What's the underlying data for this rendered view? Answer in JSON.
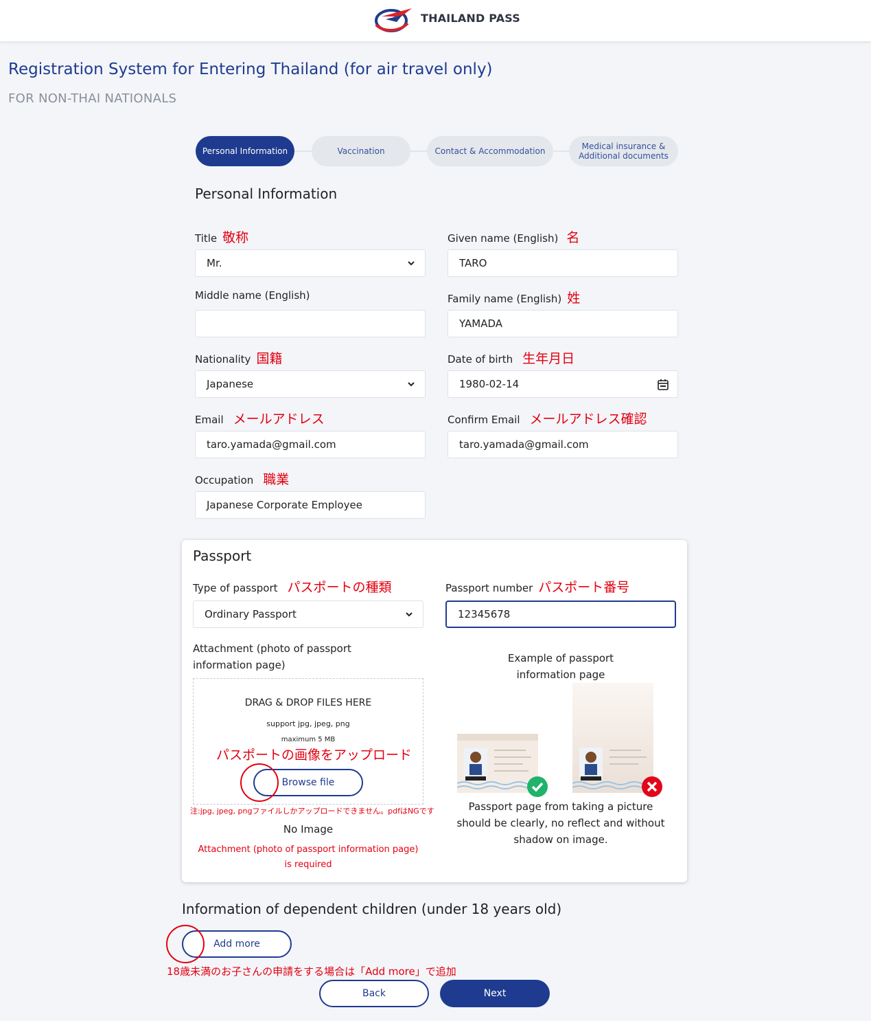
{
  "header": {
    "brand": "THAILAND PASS"
  },
  "page": {
    "title": "Registration System for Entering Thailand (for air travel only)",
    "subtitle": "FOR NON-THAI NATIONALS"
  },
  "steps": [
    {
      "label": "Personal Information",
      "active": true
    },
    {
      "label": "Vaccination",
      "active": false
    },
    {
      "label": "Contact & Accommodation",
      "active": false
    },
    {
      "label_line1": "Medical insurance &",
      "label_line2": "Additional documents",
      "active": false
    }
  ],
  "personal": {
    "heading": "Personal Information",
    "title": {
      "label": "Title",
      "jp": "敬称",
      "value": "Mr."
    },
    "given_name": {
      "label": "Given name (English)",
      "jp": "名",
      "value": "TARO"
    },
    "middle_name": {
      "label": "Middle name (English)",
      "value": ""
    },
    "family_name": {
      "label": "Family name (English)",
      "jp": "姓",
      "value": "YAMADA"
    },
    "nationality": {
      "label": "Nationality",
      "jp": "国籍",
      "value": "Japanese"
    },
    "dob": {
      "label": "Date of birth",
      "jp": "生年月日",
      "value": "1980-02-14"
    },
    "email": {
      "label": "Email",
      "jp": "メールアドレス",
      "value": "taro.yamada@gmail.com"
    },
    "confirm_email": {
      "label": "Confirm Email",
      "jp": "メールアドレス確認",
      "value": "taro.yamada@gmail.com"
    },
    "occupation": {
      "label": "Occupation",
      "jp": "職業",
      "value": "Japanese Corporate Employee"
    }
  },
  "passport": {
    "heading": "Passport",
    "type": {
      "label": "Type of passport",
      "jp": "パスポートの種類",
      "value": "Ordinary Passport"
    },
    "number": {
      "label": "Passport number",
      "jp": "パスポート番号",
      "value": "12345678"
    },
    "attachment_label_1": "Attachment (photo of passport",
    "attachment_label_2": "information page)",
    "drop_title": "DRAG & DROP FILES HERE",
    "drop_support": "support jpg, jpeg, png",
    "drop_max": "maximum 5 MB",
    "jp_upload": "パスポートの画像をアップロード",
    "browse": "Browse file",
    "jp_note": "注:jpg, jpeg, pngファイルしかアップロードできません。pdfはNGです",
    "no_image": "No Image",
    "error_1": "Attachment (photo of passport information page)",
    "error_2": "is required",
    "example_1": "Example of passport",
    "example_2": "information page",
    "caption_1": "Passport page from taking a picture",
    "caption_2": "should be clearly, no reflect and without",
    "caption_3": "shadow on image."
  },
  "children": {
    "heading": "Information of dependent children (under 18 years old)",
    "add_more": "Add more",
    "jp_note": "18歳未満のお子さんの申請をする場合は「Add more」で追加"
  },
  "nav": {
    "back": "Back",
    "next": "Next"
  },
  "colors": {
    "primary": "#1f3b8f",
    "annotation_red": "#e3000f",
    "ok_green": "#1fb36b",
    "error_red": "#e3061a"
  }
}
